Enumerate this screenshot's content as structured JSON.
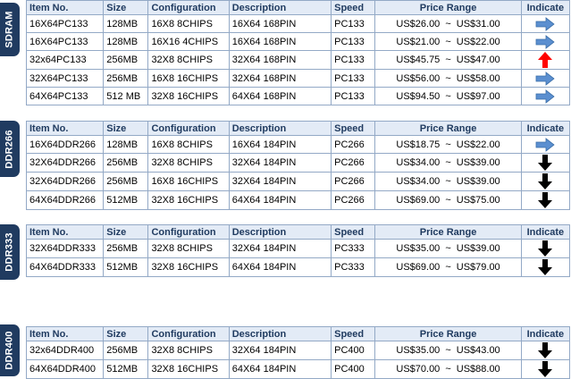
{
  "headers": {
    "item": "Item No.",
    "size": "Size",
    "config": "Configuration",
    "desc": "Description",
    "speed": "Speed",
    "price": "Price Range",
    "indicate": "Indicate"
  },
  "sections": [
    {
      "tab": "SDRAM",
      "rows": [
        {
          "item": "16X64PC133",
          "size": "128MB",
          "config": "16X8 8CHIPS",
          "desc": "16X64 168PIN",
          "speed": "PC133",
          "low": "US$26.00",
          "high": "US$31.00",
          "trend": "right-arrow-icon"
        },
        {
          "item": "16X64PC133",
          "size": "128MB",
          "config": "16X16 4CHIPS",
          "desc": "16X64 168PIN",
          "speed": "PC133",
          "low": "US$21.00",
          "high": "US$22.00",
          "trend": "right-arrow-icon"
        },
        {
          "item": "32x64PC133",
          "size": "256MB",
          "config": "32X8 8CHIPS",
          "desc": "32X64 168PIN",
          "speed": "PC133",
          "low": "US$45.75",
          "high": "US$47.00",
          "trend": "up-arrow-icon"
        },
        {
          "item": "32X64PC133",
          "size": "256MB",
          "config": "16X8 16CHIPS",
          "desc": "32X64 168PIN",
          "speed": "PC133",
          "low": "US$56.00",
          "high": "US$58.00",
          "trend": "right-arrow-icon"
        },
        {
          "item": "64X64PC133",
          "size": "512 MB",
          "config": "32X8 16CHIPS",
          "desc": "64X64 168PIN",
          "speed": "PC133",
          "low": "US$94.50",
          "high": "US$97.00",
          "trend": "right-arrow-icon"
        }
      ]
    },
    {
      "tab": "DDR266",
      "rows": [
        {
          "item": "16X64DDR266",
          "size": "128MB",
          "config": "16X8 8CHIPS",
          "desc": "16X64 184PIN",
          "speed": "PC266",
          "low": "US$18.75",
          "high": "US$22.00",
          "trend": "right-arrow-icon"
        },
        {
          "item": "32X64DDR266",
          "size": "256MB",
          "config": "32X8 8CHIPS",
          "desc": "32X64 184PIN",
          "speed": "PC266",
          "low": "US$34.00",
          "high": "US$39.00",
          "trend": "down-arrow-icon"
        },
        {
          "item": "32X64DDR266",
          "size": "256MB",
          "config": "16X8 16CHIPS",
          "desc": "32X64 184PIN",
          "speed": "PC266",
          "low": "US$34.00",
          "high": "US$39.00",
          "trend": "down-arrow-icon"
        },
        {
          "item": "64X64DDR266",
          "size": "512MB",
          "config": "32X8 16CHIPS",
          "desc": "64X64 184PIN",
          "speed": "PC266",
          "low": "US$69.00",
          "high": "US$75.00",
          "trend": "down-arrow-icon"
        }
      ]
    },
    {
      "tab": "DDR333",
      "rows": [
        {
          "item": "32X64DDR333",
          "size": "256MB",
          "config": "32X8 8CHIPS",
          "desc": "32X64 184PIN",
          "speed": "PC333",
          "low": "US$35.00",
          "high": "US$39.00",
          "trend": "down-arrow-icon"
        },
        {
          "item": "64X64DDR333",
          "size": "512MB",
          "config": "32X8 16CHIPS",
          "desc": "64X64 184PIN",
          "speed": "PC333",
          "low": "US$69.00",
          "high": "US$79.00",
          "trend": "down-arrow-icon"
        }
      ]
    },
    {
      "tab": "DDR400",
      "rows": [
        {
          "item": "32x64DDR400",
          "size": "256MB",
          "config": "32X8 8CHIPS",
          "desc": "32X64 184PIN",
          "speed": "PC400",
          "low": "US$35.00",
          "high": "US$43.00",
          "trend": "down-arrow-icon"
        },
        {
          "item": "64X64DDR400",
          "size": "512MB",
          "config": "32X8 16CHIPS",
          "desc": "64X64 184PIN",
          "speed": "PC400",
          "low": "US$70.00",
          "high": "US$88.00",
          "trend": "down-arrow-icon"
        }
      ]
    }
  ],
  "tilde": "~",
  "colors": {
    "tab_bg": "#203b60",
    "header_bg": "#e3ebf6",
    "border": "#93a9c6",
    "right_arrow": "#5b8fd0",
    "up_arrow": "#ff0000",
    "down_arrow": "#000000"
  }
}
